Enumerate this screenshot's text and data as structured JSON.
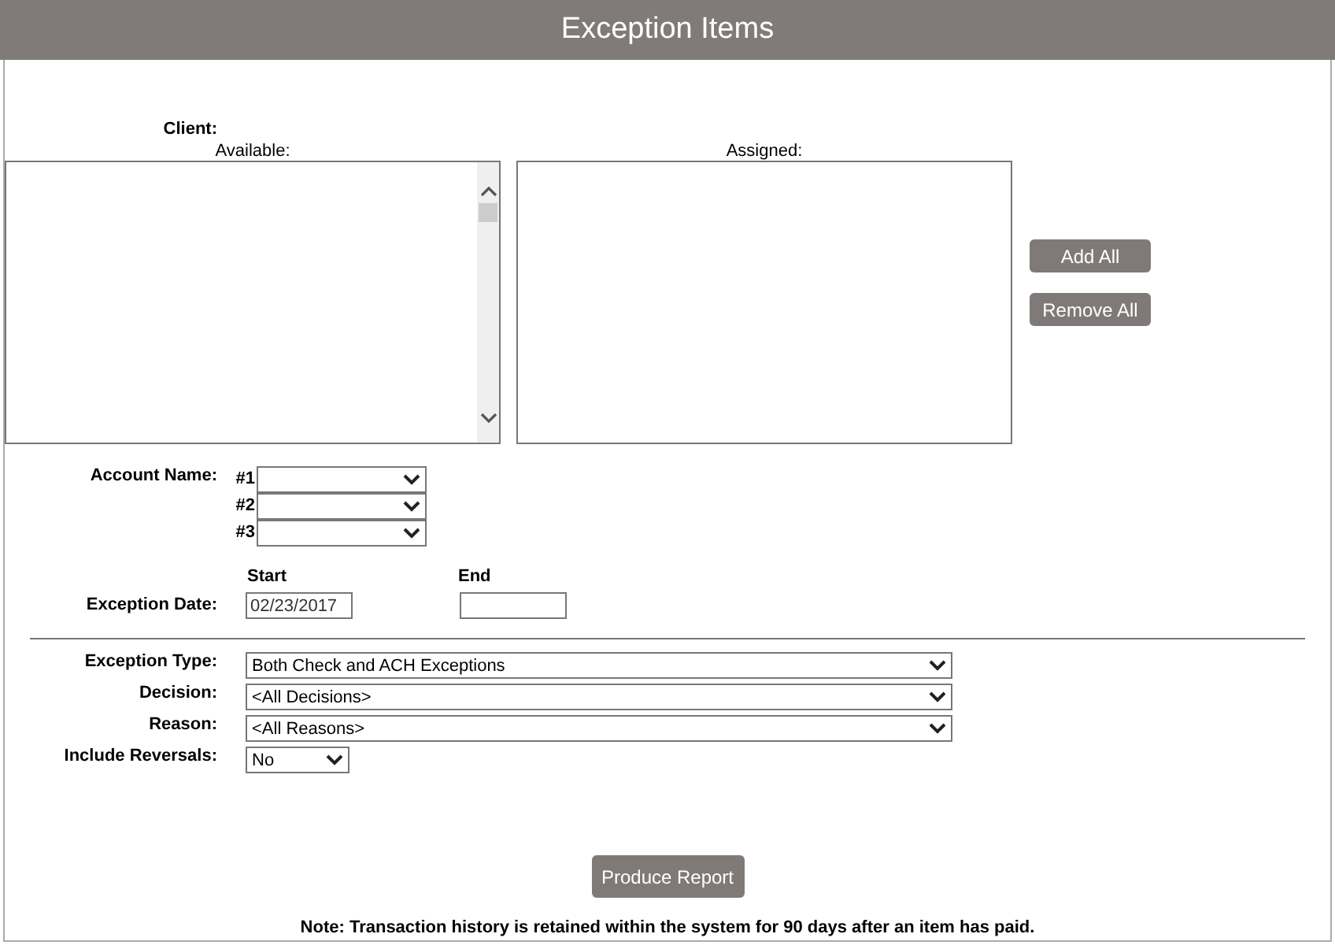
{
  "title": "Exception Items",
  "client": {
    "label": "Client:",
    "available_label": "Available:",
    "assigned_label": "Assigned:"
  },
  "list_buttons": [
    "Add All",
    "Remove All"
  ],
  "account_name": {
    "label": "Account Name:",
    "slots": [
      {
        "label": "#1"
      },
      {
        "label": "#2"
      },
      {
        "label": "#3"
      }
    ]
  },
  "exception_date": {
    "label": "Exception Date:",
    "start_label": "Start",
    "start_value": "02/23/2017",
    "end_label": "End"
  },
  "filters": [
    {
      "label": "Exception Type:",
      "value": "Both Check and ACH Exceptions",
      "kind": "wide"
    },
    {
      "label": "Decision:",
      "value": "<All Decisions>",
      "kind": "wide"
    },
    {
      "label": "Reason:",
      "value": "<All Reasons>",
      "kind": "wide"
    },
    {
      "label": "Include Reversals:",
      "value": "No",
      "kind": "narrow"
    }
  ],
  "submit": "Produce Report",
  "note": "Note: Transaction history is retained within the system for 90 days after an item has paid."
}
